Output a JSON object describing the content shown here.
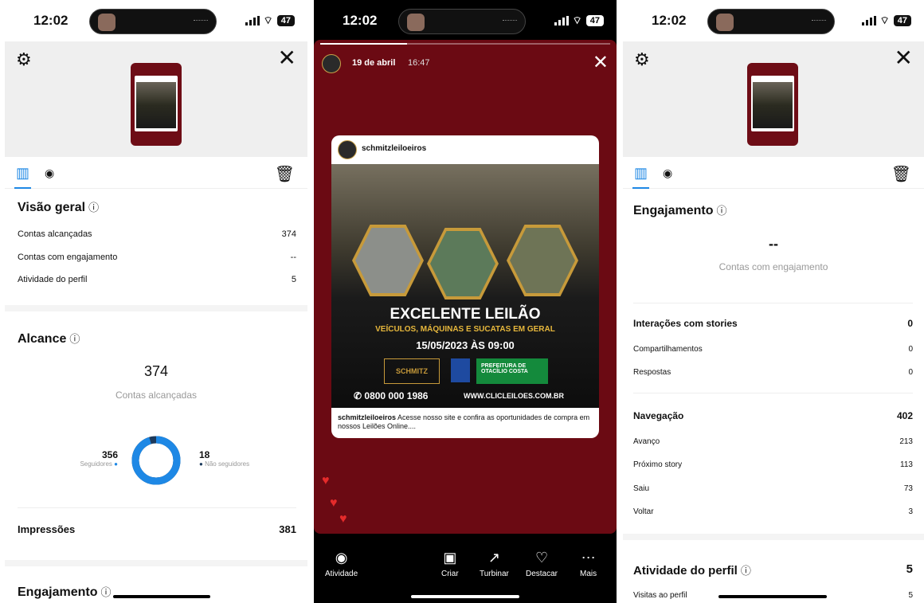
{
  "status": {
    "time": "12:02",
    "battery": "47"
  },
  "panel1": {
    "overview": {
      "title": "Visão geral",
      "rows": [
        {
          "label": "Contas alcançadas",
          "value": "374"
        },
        {
          "label": "Contas com engajamento",
          "value": "--"
        },
        {
          "label": "Atividade do perfil",
          "value": "5"
        }
      ]
    },
    "reach": {
      "title": "Alcance",
      "number": "374",
      "subtitle": "Contas alcançadas",
      "followers_value": "356",
      "followers_label": "Seguidores",
      "nonfollowers_value": "18",
      "nonfollowers_label": "Não seguidores",
      "followers_share": 0.952
    },
    "impressions": {
      "label": "Impressões",
      "value": "381"
    },
    "engagement_title": "Engajamento"
  },
  "panel2": {
    "date": "19 de abril",
    "time": "16:47",
    "username": "schmitzleiloeiros",
    "headline": "EXCELENTE LEILÃO",
    "subheadline": "VEÍCULOS, MÁQUINAS E SUCATAS EM GERAL",
    "datetime": "15/05/2023 ÀS 09:00",
    "brand": "SCHMITZ",
    "prefeitura_line1": "PREFEITURA DE",
    "prefeitura_line2": "OTACÍLIO COSTA",
    "phone": "0800 000 1986",
    "site": "WWW.CLICLEILOES.COM.BR",
    "caption_user": "schmitzleiloeiros",
    "caption_text": "Acesse nosso site e confira as oportunidades de compra em nossos Leilões Online....",
    "actions": {
      "atividade": "Atividade",
      "criar": "Criar",
      "turbinar": "Turbinar",
      "destacar": "Destacar",
      "mais": "Mais"
    }
  },
  "panel3": {
    "engagement": {
      "title": "Engajamento",
      "number": "--",
      "subtitle": "Contas com engajamento"
    },
    "interactions": {
      "title": "Interações com stories",
      "value": "0",
      "rows": [
        {
          "label": "Compartilhamentos",
          "value": "0"
        },
        {
          "label": "Respostas",
          "value": "0"
        }
      ]
    },
    "navigation": {
      "title": "Navegação",
      "value": "402",
      "rows": [
        {
          "label": "Avanço",
          "value": "213"
        },
        {
          "label": "Próximo story",
          "value": "113"
        },
        {
          "label": "Saiu",
          "value": "73"
        },
        {
          "label": "Voltar",
          "value": "3"
        }
      ]
    },
    "profile_activity": {
      "title": "Atividade do perfil",
      "value": "5",
      "rows": [
        {
          "label": "Visitas ao perfil",
          "value": "5"
        }
      ]
    }
  },
  "colors": {
    "accent": "#1e88e5",
    "story_bg": "#6b0a13",
    "ring_secondary": "#1c3a5c"
  },
  "icons": [
    "gear-icon",
    "close-icon",
    "chart-icon",
    "eye-icon",
    "trash-icon",
    "info-icon",
    "heart-icon",
    "create-icon",
    "boost-icon",
    "highlight-icon",
    "more-icon"
  ]
}
